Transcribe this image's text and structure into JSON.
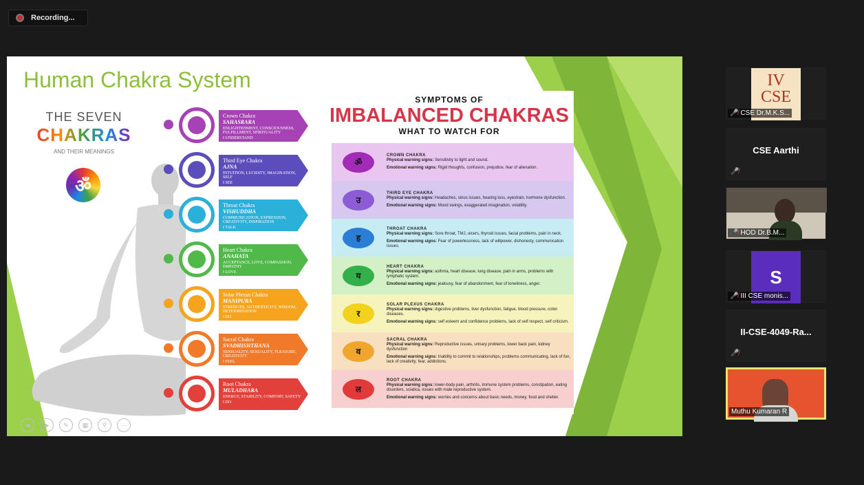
{
  "recording": {
    "label": "Recording..."
  },
  "slide": {
    "title": "Human Chakra System",
    "left_panel": {
      "line1": "THE SEVEN",
      "line2": "CHAKRAS",
      "line3": "AND THEIR MEANINGS",
      "om": "ॐ"
    },
    "chakras": [
      {
        "name": "Crown Chakra",
        "sanskrit": "SAHASRARA",
        "meaning": "ENLIGHTENMENT, CONSCIOUSNESS, FULFILLMENT, SPIRITUALITY",
        "mantra": "I UNDERSTAND",
        "color": "#a642b3"
      },
      {
        "name": "Third Eye Chakra",
        "sanskrit": "AJNA",
        "meaning": "INTUITION, LUCIDITY, IMAGINATION, SELF",
        "mantra": "I SEE",
        "color": "#5b4dbb"
      },
      {
        "name": "Throat Chakra",
        "sanskrit": "VISHUDDHA",
        "meaning": "COMMUNICATION, EXPRESSION, CREATIVITY, INSPIRATION",
        "mantra": "I TALK",
        "color": "#2ab0d9"
      },
      {
        "name": "Heart Chakra",
        "sanskrit": "ANAHATA",
        "meaning": "ACCEPTANCE, LOVE, COMPASSION, EMPATHY",
        "mantra": "I LOVE",
        "color": "#51b84a"
      },
      {
        "name": "Solar Plexus Chakra",
        "sanskrit": "MANIPURA",
        "meaning": "STRENGTH, AUTHENTICITY, WISDOM, DETERMINATION",
        "mantra": "I DO",
        "color": "#f6a31e"
      },
      {
        "name": "Sacral Chakra",
        "sanskrit": "SVADHISHTHANA",
        "meaning": "SENSUALITY, SEXUALITY, PLEASURE, CREATIVITY",
        "mantra": "I FEEL",
        "color": "#f17a2a"
      },
      {
        "name": "Root Chakra",
        "sanskrit": "MULADHARA",
        "meaning": "ENERGY, STABILITY, COMFORT, SAFETY",
        "mantra": "I DO",
        "color": "#e2403a"
      }
    ],
    "symptoms": {
      "heading1": "SYMPTOMS OF",
      "heading2": "IMBALANCED CHAKRAS",
      "heading3": "WHAT TO WATCH FOR",
      "rows": [
        {
          "title": "CROWN CHAKRA",
          "glyph": "ॐ",
          "bg": "#e9c6ef",
          "glyph_bg": "#a22bb8",
          "physical": "Sensitivity to light and sound.",
          "emotional": "Rigid thoughts, confusion, prejudice, fear of alienation."
        },
        {
          "title": "THIRD EYE CHAKRA",
          "glyph": "उ",
          "bg": "#d7c8f0",
          "glyph_bg": "#8c5bd6",
          "physical": "Headaches, sinus issues, hearing loss, eyestrain, hormone dysfunction.",
          "emotional": "Mood swings, exaggerated imagination, volatility."
        },
        {
          "title": "THROAT CHAKRA",
          "glyph": "ह",
          "bg": "#c8ecf4",
          "glyph_bg": "#2a7ed6",
          "physical": "Sore throat, TMJ, ulcers, thyroid issues, facial problems, pain in neck.",
          "emotional": "Fear of powerlessness, lack of willpower, dishonesty, communication issues."
        },
        {
          "title": "HEART CHAKRA",
          "glyph": "य",
          "bg": "#d4f0c7",
          "glyph_bg": "#34b04a",
          "physical": "asthma, heart disease, lung disease, pain in arms, problems with lymphatic system.",
          "emotional": "jealousy, fear of abandonment, fear of loneliness, anger."
        },
        {
          "title": "SOLAR PLEXUS CHAKRA",
          "glyph": "र",
          "bg": "#f6f3bd",
          "glyph_bg": "#f2d21d",
          "physical": "digestive problems, liver dysfunction, fatigue, blood pressure, colon diseases.",
          "emotional": "self esteem and confidence problems, lack of self respect, self criticism."
        },
        {
          "title": "SACRAL CHAKRA",
          "glyph": "व",
          "bg": "#f8dfc0",
          "glyph_bg": "#f0a52c",
          "physical": "Reproductive issues, urinary problems, lower back pain, kidney dysfunction",
          "emotional": "Inability to commit to relationships, problems communicating, lack of fun, lack of creativity, fear, addictions."
        },
        {
          "title": "ROOT CHAKRA",
          "glyph": "ल",
          "bg": "#f7cfcf",
          "glyph_bg": "#e23a3a",
          "physical": "lower-body pain, arthritis, immune system problems, constipation, eating disorders, sciatica, issues with male reproductive system.",
          "emotional": "worries and concerns about basic needs, money, food and shelter."
        }
      ],
      "physical_label": "Physical warning signs:",
      "emotional_label": "Emotional warning signs:"
    }
  },
  "participants": [
    {
      "name": "CSE Dr.M.K.S...",
      "type": "image",
      "image_text": "IV CSE",
      "muted": true
    },
    {
      "name": "CSE Aarthi",
      "type": "name",
      "muted": true
    },
    {
      "name": "HOD Dr.B.M...",
      "type": "video",
      "muted": true
    },
    {
      "name": "III CSE monis...",
      "type": "avatar",
      "initial": "S",
      "avatar_color": "#5b2dbd",
      "muted": true
    },
    {
      "name": "II-CSE-4049-Ra...",
      "type": "name",
      "muted": true
    },
    {
      "name": "Muthu Kumaran R",
      "type": "video",
      "muted": false,
      "active": true
    }
  ],
  "colors": {
    "accent_green": "#8dbf3a",
    "speaker_border": "#e9e46b",
    "muted_red": "#e23b3b"
  }
}
